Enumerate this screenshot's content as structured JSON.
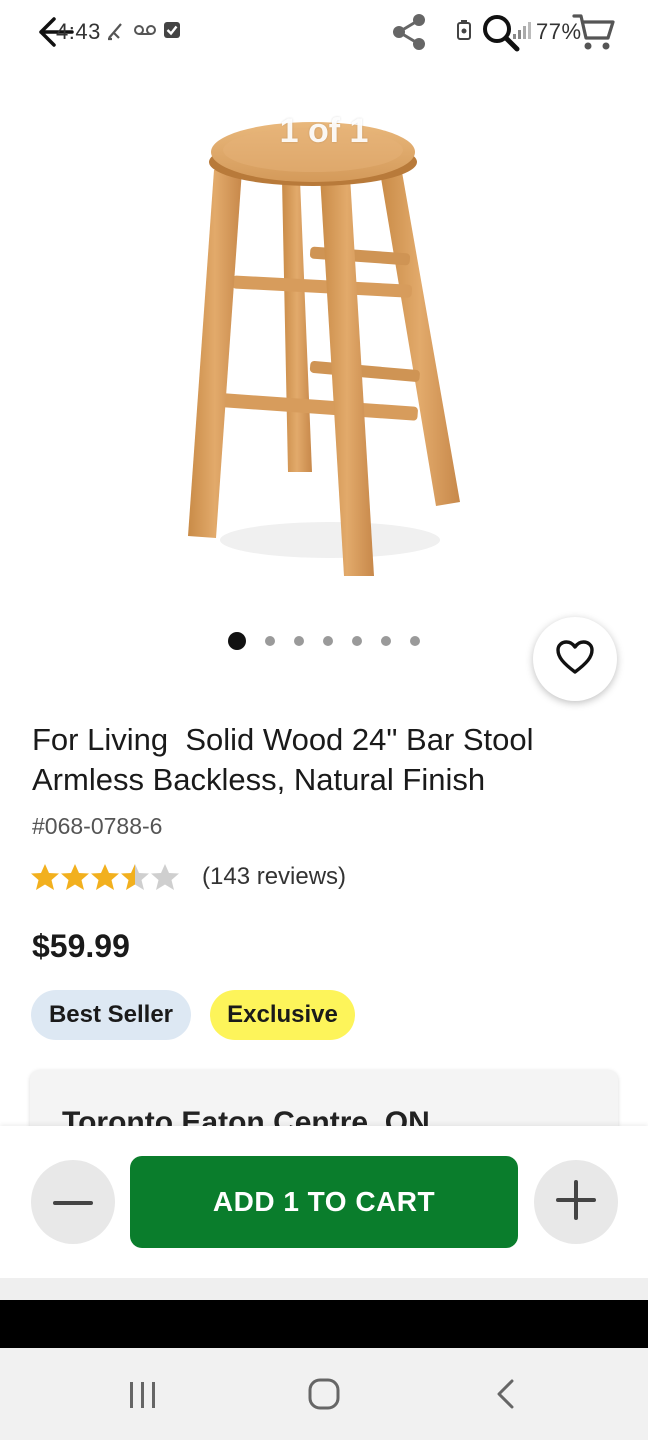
{
  "status_bar": {
    "time": "4:43",
    "battery": "77%"
  },
  "top_bar": {
    "icons": [
      "back-arrow-icon",
      "share-icon",
      "search-icon",
      "cart-icon"
    ]
  },
  "gallery": {
    "counter": "1 of 1",
    "dot_count": 7,
    "active_dot": 0
  },
  "product": {
    "title": "For Living  Solid Wood 24\" Bar Stool Armless Backless, Natural Finish",
    "sku": "#068-0788-6",
    "rating": 3.5,
    "reviews": "(143 reviews)",
    "price": "$59.99",
    "badges": {
      "best_seller": "Best Seller",
      "exclusive": "Exclusive"
    }
  },
  "store": {
    "name": "Toronto Eaton Centre, ON"
  },
  "cart": {
    "add_label": "ADD 1 TO CART",
    "minus_icon": "minus-icon",
    "plus_icon": "plus-icon",
    "accent": "#0a7d2c"
  },
  "colors": {
    "star": "#f2b01e",
    "star_empty": "#cfcfcf",
    "best_seller_bg": "#dde8f3",
    "exclusive_bg": "#fdf45a"
  }
}
